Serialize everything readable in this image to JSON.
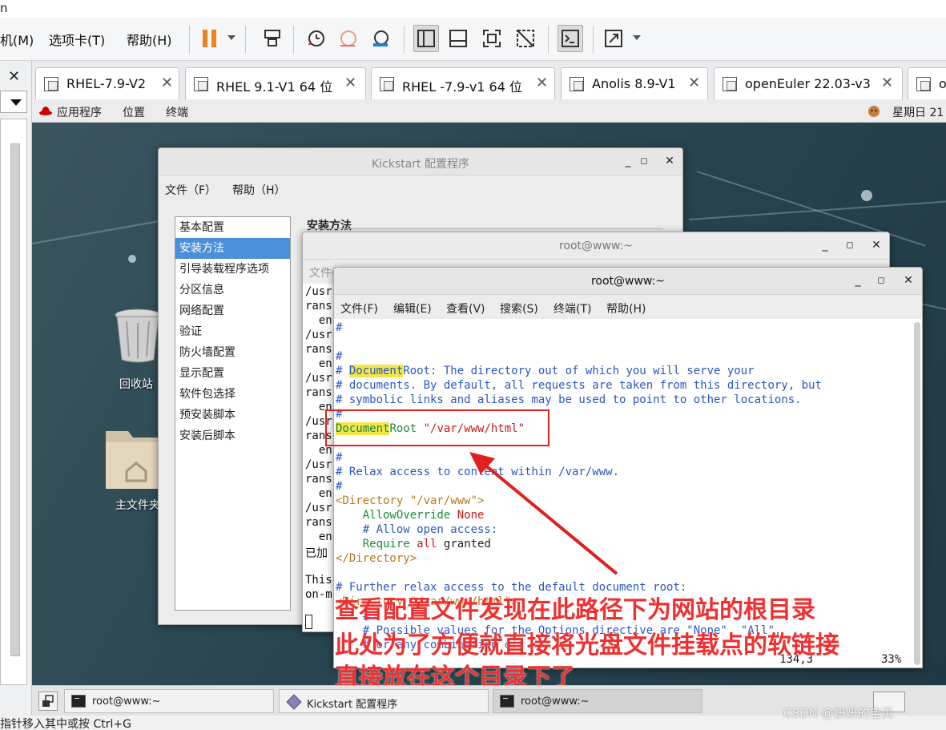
{
  "host": {
    "title_fragment": "n",
    "menu": [
      "机(M)",
      "选项卡(T)",
      "帮助(H)"
    ],
    "status_text": "指针移入其中或按 Ctrl+G"
  },
  "vm_tabs": [
    {
      "label": "RHEL-7.9-V2"
    },
    {
      "label": "RHEL 9.1-V1 64 位"
    },
    {
      "label": "RHEL -7.9-v1 64 位"
    },
    {
      "label": "Anolis 8.9-V1"
    },
    {
      "label": "openEuler 22.03-v3"
    },
    {
      "label": "o"
    }
  ],
  "gnome_bar": {
    "apps": "应用程序",
    "places": "位置",
    "terminal": "终端",
    "clock": "星期日 21"
  },
  "desktop": {
    "trash_label": "回收站",
    "home_label": "主文件夹"
  },
  "kickstart": {
    "title": "Kickstart 配置程序",
    "menu": [
      "文件（F）",
      "帮助（H）"
    ],
    "items": [
      "基本配置",
      "安装方法",
      "引导装载程序选项",
      "分区信息",
      "网络配置",
      "验证",
      "防火墙配置",
      "显示配置",
      "软件包选择",
      "预安装脚本",
      "安装后脚本"
    ],
    "selected_index": 1,
    "heading": "安装方法"
  },
  "terminal_back": {
    "title": "root@www:~",
    "menu_visible": "文件(",
    "lines": [
      "/usr",
      "rans",
      "  en",
      "/usr",
      "rans",
      "  en",
      "/usr",
      "rans",
      "  en",
      "/usr",
      "rans",
      "  en",
      "/usr",
      "rans",
      "  en",
      "/usr",
      "rans",
      "  en",
      "已加",
      "",
      "This",
      "on-m"
    ]
  },
  "terminal_front": {
    "title": "root@www:~",
    "menu": [
      "文件(F)",
      "编辑(E)",
      "查看(V)",
      "搜索(S)",
      "终端(T)",
      "帮助(H)"
    ],
    "code": {
      "l0": "#",
      "l2": "#",
      "l3_hl": "Document",
      "l3_rest": "Root: The directory out of which you will serve your",
      "l4": "# documents. By default, all requests are taken from this directory, but",
      "l5": "# symbolic links and aliases may be used to point to other locations.",
      "l6": "#",
      "l7_hl": "Document",
      "l7_key": "Root",
      "l7_str": "\"/var/www/html\"",
      "l9": "#",
      "l10": "# Relax access to content within /var/www.",
      "l11": "#",
      "l12_dir": "<Directory \"/var/www\">",
      "l13_key": "AllowOverride",
      "l13_val": "None",
      "l14": "# Allow open access:",
      "l15_key": "Require",
      "l15_kw": "all",
      "l15_val": "granted",
      "l16_dir": "</Directory>",
      "l18": "# Further relax access to the default document root:",
      "l19": "<Directory \"/var/www/html\">",
      "l20": "    #",
      "l21": "    # Possible values for the Options directive are \"None\", \"All\",",
      "l22": "    # or any combination of:"
    },
    "position": "134,3",
    "percent": "33%"
  },
  "annotation": {
    "line1": "查看配置文件发现在此路径下为网站的根目录",
    "line2": "此处为了方便就直接将光盘文件挂载点的软链接",
    "line3": "直接放在这个目录下了"
  },
  "taskbar": [
    {
      "label": "root@www:~"
    },
    {
      "label": "Kickstart 配置程序"
    },
    {
      "label": "root@www:~"
    }
  ],
  "watermark": "CSDN @妍妍的宝贝",
  "colors": {
    "annotation": "#e02020",
    "selection": "#4a90d9",
    "comment": "#2b56c4"
  }
}
